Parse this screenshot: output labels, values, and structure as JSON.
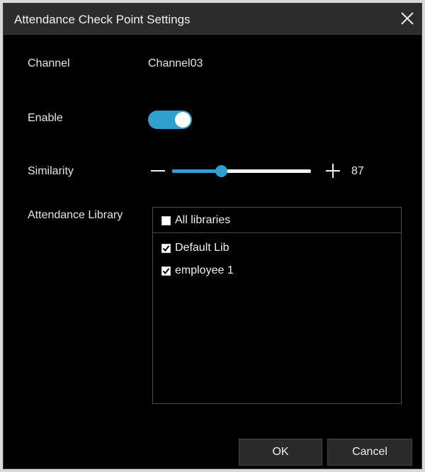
{
  "dialog": {
    "title": "Attendance Check Point Settings",
    "close_icon": "close-icon"
  },
  "channel": {
    "label": "Channel",
    "value": "Channel03"
  },
  "enable": {
    "label": "Enable",
    "on": true
  },
  "similarity": {
    "label": "Similarity",
    "value": "87",
    "level_percent": 35
  },
  "library": {
    "label": "Attendance Library",
    "all_label": "All libraries",
    "all_checked": false,
    "items": [
      {
        "label": "Default Lib",
        "checked": true
      },
      {
        "label": "employee 1",
        "checked": true
      }
    ]
  },
  "buttons": {
    "ok": "OK",
    "cancel": "Cancel"
  },
  "colors": {
    "accent": "#2fa0cf",
    "background": "#000000",
    "titlebar": "#2c2c2c"
  }
}
